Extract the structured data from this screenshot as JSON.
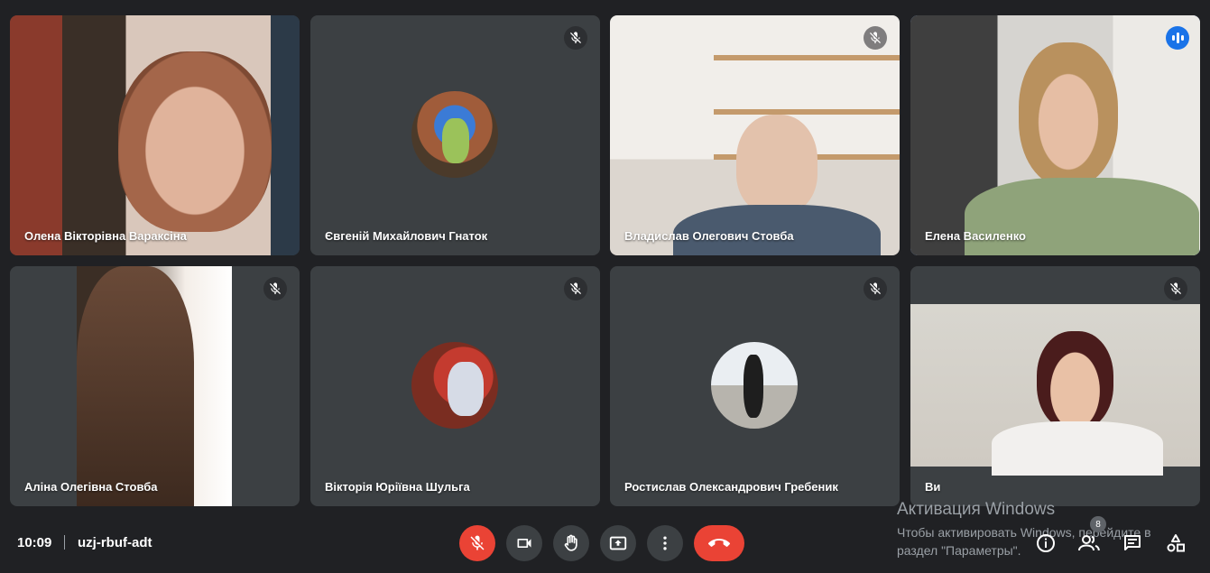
{
  "participants": [
    {
      "name": "Олена Вікторівна Вараксіна"
    },
    {
      "name": "Євгеній Михайлович Гнаток"
    },
    {
      "name": "Владислав Олегович Стовба"
    },
    {
      "name": "Елена Василенко"
    },
    {
      "name": "Аліна Олегівна Стовба"
    },
    {
      "name": "Вікторія Юріївна Шульга"
    },
    {
      "name": "Ростислав Олександрович Гребеник"
    },
    {
      "name": "Ви"
    }
  ],
  "bottom_bar": {
    "time": "10:09",
    "meeting_code": "uzj-rbuf-adt",
    "participants_count": "8"
  },
  "watermark": {
    "line1": "Активация Windows",
    "line2": "Чтобы активировать Windows, перейдите в",
    "line3": "раздел \"Параметры\"."
  },
  "colors": {
    "background": "#202124",
    "tile": "#3c4043",
    "danger": "#ea4335",
    "speaking": "#8ab4f8"
  },
  "icons": [
    "mic-off-icon",
    "camera-icon",
    "raise-hand-icon",
    "present-screen-icon",
    "more-options-icon",
    "end-call-icon",
    "info-icon",
    "people-icon",
    "chat-icon",
    "activities-icon",
    "speaking-indicator-icon"
  ]
}
